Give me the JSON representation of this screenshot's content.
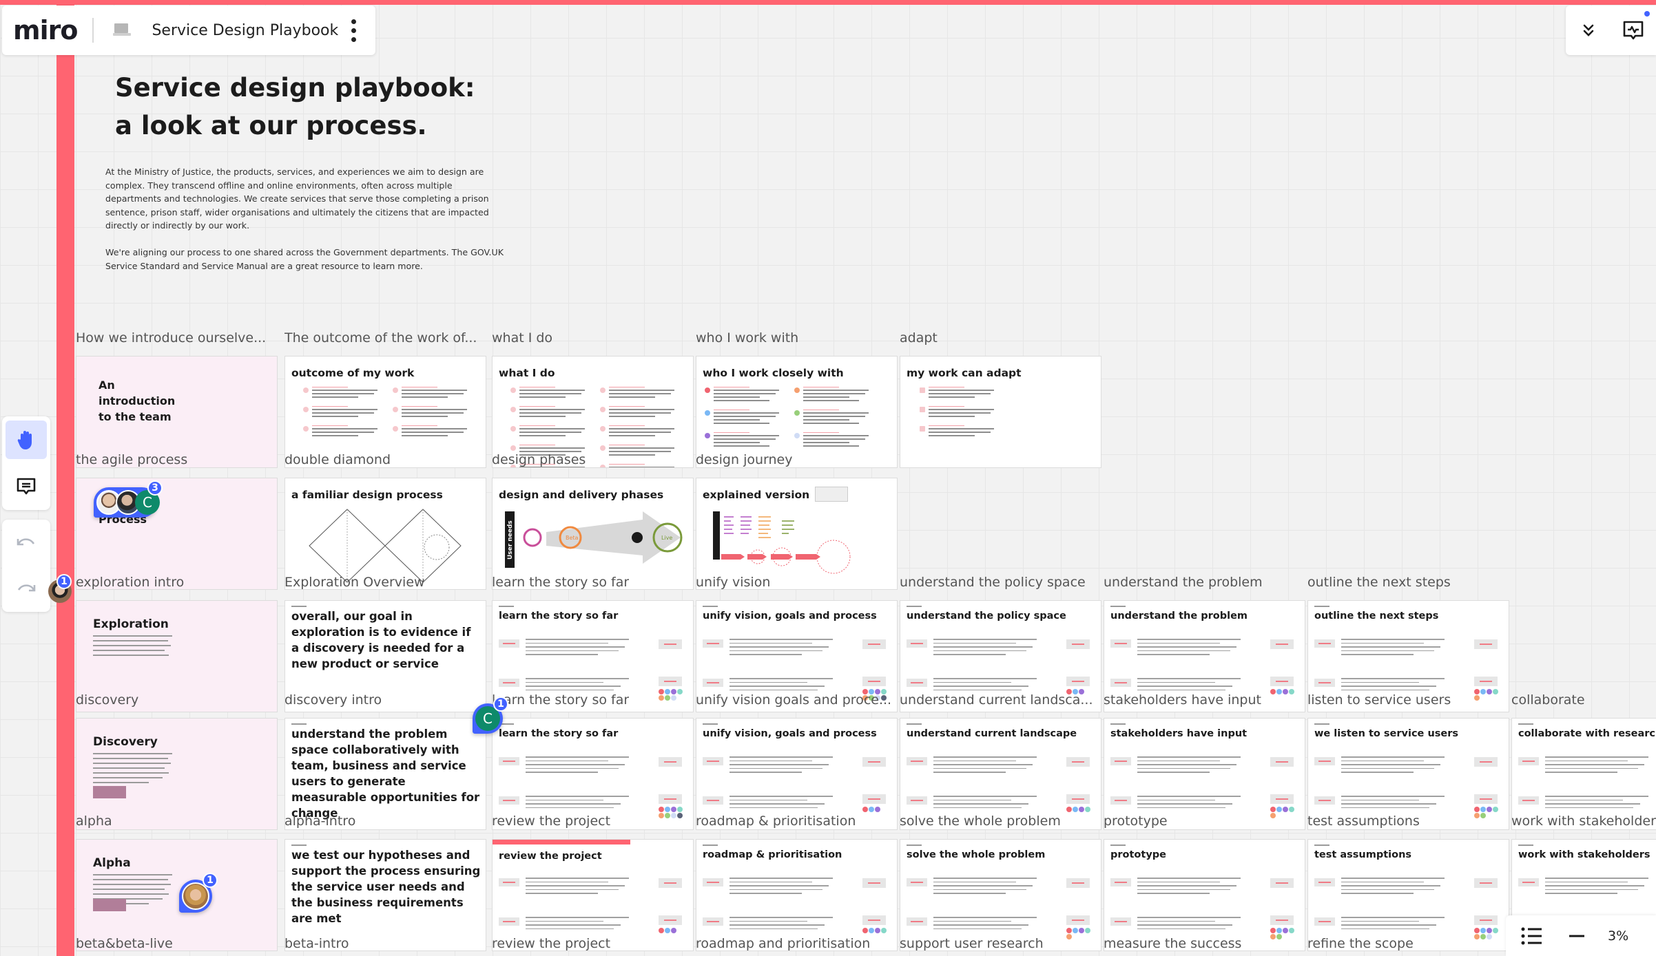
{
  "header": {
    "logo": "miro",
    "board_title": "Service Design Playbook",
    "more_icon": "more-vertical-icon"
  },
  "top_right": {
    "collapse_icon": "chevrons-down-icon",
    "activity_icon": "activity-feed-icon",
    "notification_color": "#4262ff"
  },
  "toolbar": {
    "tools": [
      {
        "name": "hand-tool",
        "icon": "hand-icon",
        "active": true
      },
      {
        "name": "comment-tool",
        "icon": "comment-icon",
        "active": false
      }
    ],
    "history": [
      {
        "name": "undo",
        "icon": "undo-icon"
      },
      {
        "name": "redo",
        "icon": "redo-icon"
      }
    ]
  },
  "intro": {
    "title_line1": "Service design playbook:",
    "title_line2": "a look at our process.",
    "paragraph1": "At the Ministry of Justice, the products, services, and experiences we aim to design are complex. They transcend offline and online environments, often across multiple departments and technologies. We create services that serve those completing a prison sentence, prison staff, wider organisations and ultimately the citizens that are impacted directly or indirectly by our work.",
    "paragraph2": "We're aligning our process to one shared across the Government departments. The GOV.UK Service Standard and Service Manual are a great resource to learn more."
  },
  "frames": [
    {
      "row": 0,
      "col": 0,
      "label": "How we introduce ourselve...",
      "kind": "intro",
      "title": "An introduction to the team"
    },
    {
      "row": 0,
      "col": 1,
      "label": "The outcome of the work of...",
      "kind": "list2",
      "title": "outcome of my work"
    },
    {
      "row": 0,
      "col": 2,
      "label": "what I do",
      "kind": "list2",
      "title": "what I do"
    },
    {
      "row": 0,
      "col": 3,
      "label": "who I work with",
      "kind": "people",
      "title": "who I work closely with"
    },
    {
      "row": 0,
      "col": 4,
      "label": "adapt",
      "kind": "list1",
      "title": "my work can adapt"
    },
    {
      "row": 1,
      "col": 0,
      "label": "the agile process",
      "kind": "intro",
      "title": "Process"
    },
    {
      "row": 1,
      "col": 1,
      "label": "double diamond",
      "kind": "diamond",
      "title": "a familiar design process"
    },
    {
      "row": 1,
      "col": 2,
      "label": "design phases",
      "kind": "phases",
      "title": "design and delivery phases",
      "phase_labels": [
        "User needs",
        "Beta",
        "Live"
      ]
    },
    {
      "row": 1,
      "col": 3,
      "label": "design journey",
      "kind": "explained",
      "title": "explained version"
    },
    {
      "row": 2,
      "col": 0,
      "label": "exploration intro",
      "kind": "section",
      "title": "Exploration"
    },
    {
      "row": 2,
      "col": 1,
      "label": "Exploration Overview",
      "kind": "statement",
      "title": "overall, our goal in exploration is to evidence if a discovery is needed for a new product or service"
    },
    {
      "row": 2,
      "col": 2,
      "label": "learn the story so far",
      "kind": "qm",
      "title": "learn the story so far"
    },
    {
      "row": 2,
      "col": 3,
      "label": "unify vision",
      "kind": "qm",
      "title": "unify vision, goals and process"
    },
    {
      "row": 2,
      "col": 4,
      "label": "understand the policy space",
      "kind": "qm",
      "title": "understand the policy space"
    },
    {
      "row": 2,
      "col": 5,
      "label": "understand the problem",
      "kind": "qm",
      "title": "understand the problem"
    },
    {
      "row": 2,
      "col": 6,
      "label": "outline the next steps",
      "kind": "qm",
      "title": "outline the next steps"
    },
    {
      "row": 3,
      "col": 0,
      "label": "discovery",
      "kind": "section",
      "title": "Discovery",
      "has_button": true
    },
    {
      "row": 3,
      "col": 1,
      "label": "discovery intro",
      "kind": "statement",
      "title": "understand the problem space collaboratively with team, business and service users to generate measurable opportunities for change"
    },
    {
      "row": 3,
      "col": 2,
      "label": "learn the story so far",
      "kind": "qm",
      "title": "learn the story so far"
    },
    {
      "row": 3,
      "col": 3,
      "label": "unify vision goals and proce...",
      "kind": "qm",
      "title": "unify vision, goals and process"
    },
    {
      "row": 3,
      "col": 4,
      "label": "understand current landsca...",
      "kind": "qm",
      "title": "understand current landscape"
    },
    {
      "row": 3,
      "col": 5,
      "label": "stakeholders have input",
      "kind": "qm",
      "title": "stakeholders have input"
    },
    {
      "row": 3,
      "col": 6,
      "label": "listen to service users",
      "kind": "qm",
      "title": "we listen to service users"
    },
    {
      "row": 3,
      "col": 7,
      "label": "collaborate",
      "kind": "qm",
      "title": "collaborate with research"
    },
    {
      "row": 4,
      "col": 0,
      "label": "alpha",
      "kind": "section",
      "title": "Alpha",
      "has_button": true
    },
    {
      "row": 4,
      "col": 1,
      "label": "alpha-intro",
      "kind": "statement",
      "title": "we test our hypotheses and support the process ensuring the service user needs and the business requirements are met"
    },
    {
      "row": 4,
      "col": 2,
      "label": "review the project",
      "kind": "qm",
      "title": "review the project",
      "banner": true
    },
    {
      "row": 4,
      "col": 3,
      "label": "roadmap & prioritisation",
      "kind": "qm",
      "title": "roadmap & prioritisation"
    },
    {
      "row": 4,
      "col": 4,
      "label": "solve the whole problem",
      "kind": "qm",
      "title": "solve the whole problem"
    },
    {
      "row": 4,
      "col": 5,
      "label": "prototype",
      "kind": "qm",
      "title": "prototype"
    },
    {
      "row": 4,
      "col": 6,
      "label": "test assumptions",
      "kind": "qm",
      "title": "test assumptions"
    },
    {
      "row": 4,
      "col": 7,
      "label": "work with stakeholders",
      "kind": "qm",
      "title": "work with stakeholders"
    }
  ],
  "bottom_labels": [
    {
      "col": 0,
      "label": "beta&beta-live"
    },
    {
      "col": 1,
      "label": "beta-intro"
    },
    {
      "col": 2,
      "label": "review the project"
    },
    {
      "col": 3,
      "label": "roadmap and prioritisation"
    },
    {
      "col": 4,
      "label": "support user research"
    },
    {
      "col": 5,
      "label": "measure the success"
    },
    {
      "col": 6,
      "label": "refine the scope"
    }
  ],
  "collaborators": [
    {
      "name": "group-presence",
      "count": "3",
      "letter": "C"
    },
    {
      "name": "left-edge-presence",
      "count": "1"
    },
    {
      "name": "c-presence",
      "count": "1",
      "letter": "C"
    },
    {
      "name": "alpha-presence",
      "count": "1"
    }
  ],
  "zoom": {
    "value": "3%",
    "list_icon": "frames-list-icon",
    "zoom_out_icon": "minus-icon"
  },
  "colors": {
    "accent": "#4262ff",
    "brand_red": "#ff6471",
    "pink_frame": "#fbeef6",
    "avatar_green": "#0e8a6a"
  }
}
